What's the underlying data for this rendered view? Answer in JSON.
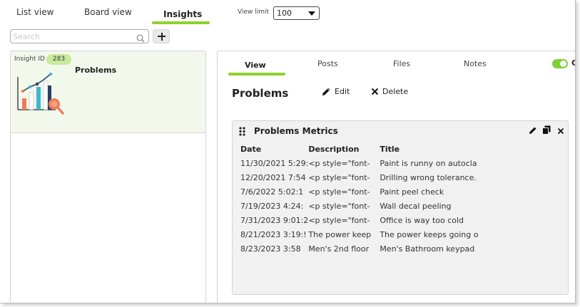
{
  "topnav": {
    "tabs": [
      {
        "label": "List view",
        "active": false
      },
      {
        "label": "Board view",
        "active": false
      },
      {
        "label": "Insights",
        "active": true
      }
    ],
    "view_limit_label": "View limit",
    "view_limit_value": "100"
  },
  "search": {
    "placeholder": "Search",
    "value": ""
  },
  "insight_card": {
    "id_label": "Insight ID",
    "id_value": "283",
    "title": "Problems"
  },
  "detail": {
    "tabs": [
      {
        "label": "View",
        "active": true
      },
      {
        "label": "Posts",
        "active": false
      },
      {
        "label": "Files",
        "active": false
      },
      {
        "label": "Notes",
        "active": false
      }
    ],
    "toggle_on": true,
    "toggle_letter": "C",
    "title": "Problems",
    "edit_label": "Edit",
    "delete_label": "Delete"
  },
  "widget": {
    "title": "Problems Metrics",
    "columns": [
      "Date",
      "Description",
      "Title"
    ],
    "rows": [
      [
        "11/30/2021 5:29:",
        "<p style=\"font-",
        "Paint is runny on autocla"
      ],
      [
        "12/20/2021 7:54",
        "<p style=\"font-",
        "Drilling wrong tolerance."
      ],
      [
        "7/6/2022 5:02:1",
        "<p style=\"font-",
        "Paint peel check"
      ],
      [
        "7/19/2023 4:24:",
        "<p style=\"font-",
        "Wall decal peeling"
      ],
      [
        "7/31/2023 9:01:2",
        "<p style=\"font-",
        "Office is way too cold"
      ],
      [
        "8/21/2023 3:19:!",
        "The power keep",
        "The power keeps going o"
      ],
      [
        "8/23/2023 3:58",
        "Men's 2nd floor",
        "Men's Bathroom keypad"
      ]
    ]
  },
  "colors": {
    "accent": "#8dd22e",
    "card_bg": "#f2f9ec",
    "badge_bg": "#c9eb9c",
    "widget_bg": "#f1f1f1"
  },
  "icons": {
    "search": "magnifier-icon",
    "add": "plus-icon",
    "edit": "pencil-icon",
    "delete": "x-icon",
    "drag": "drag-handle-icon",
    "copy": "copy-icon",
    "close": "close-icon",
    "chart": "chart-magnifier-illustration"
  }
}
